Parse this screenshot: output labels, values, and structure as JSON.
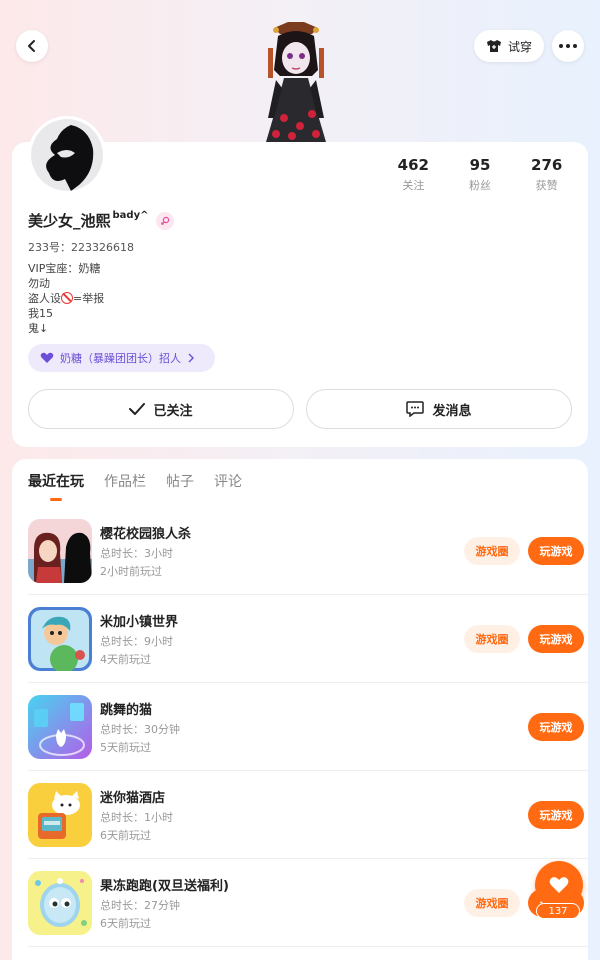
{
  "header": {
    "tryon_label": "试穿"
  },
  "profile": {
    "stats": [
      {
        "value": "462",
        "label": "关注"
      },
      {
        "value": "95",
        "label": "粉丝"
      },
      {
        "value": "276",
        "label": "获赞"
      }
    ],
    "nickname": "美少女_池熙",
    "nickname_sup": "bady^",
    "account_id": "233号：223326618",
    "bio": {
      "line1": "VIP宝座：奶糖",
      "line2": "勿动",
      "line3_a": "盗人设",
      "line3_b": "=举报",
      "line4": "我15",
      "line5": "鬼↓"
    },
    "recruit_label": "奶糖（暴躁团团长）招人",
    "followed_label": "已关注",
    "message_label": "发消息"
  },
  "tabs": [
    "最近在玩",
    "作品栏",
    "帖子",
    "评论"
  ],
  "games": [
    {
      "title": "樱花校园狼人杀",
      "duration": "总时长：3小时",
      "last_played": "2小时前玩过",
      "circle": "游戏圈",
      "play": "玩游戏"
    },
    {
      "title": "米加小镇世界",
      "duration": "总时长：9小时",
      "last_played": "4天前玩过",
      "circle": "游戏圈",
      "play": "玩游戏"
    },
    {
      "title": "跳舞的猫",
      "duration": "总时长：30分钟",
      "last_played": "5天前玩过",
      "play": "玩游戏"
    },
    {
      "title": "迷你猫酒店",
      "duration": "总时长：1小时",
      "last_played": "6天前玩过",
      "play": "玩游戏"
    },
    {
      "title": "果冻跑跑(双旦送福利)",
      "duration": "总时长：27分钟",
      "last_played": "6天前玩过",
      "circle": "游戏圈",
      "play": "玩游戏"
    }
  ],
  "like_fab": {
    "count": "137"
  },
  "colors": {
    "accent": "#ff6a13",
    "recruit": "#6b4fd6"
  }
}
